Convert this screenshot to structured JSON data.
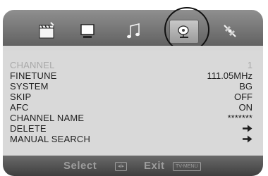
{
  "tabs": [
    {
      "icon": "clapperboard-icon",
      "selected": false
    },
    {
      "icon": "monitor-icon",
      "selected": false
    },
    {
      "icon": "music-note-icon",
      "selected": false
    },
    {
      "icon": "satellite-dish-icon",
      "selected": true
    },
    {
      "icon": "satellite-icon",
      "selected": false
    }
  ],
  "menu": {
    "items": [
      {
        "label": "CHANNEL",
        "value": "1",
        "disabled": true
      },
      {
        "label": "FINETUNE",
        "value": "111.05MHz"
      },
      {
        "label": "SYSTEM",
        "value": "BG"
      },
      {
        "label": "SKIP",
        "value": "OFF"
      },
      {
        "label": "AFC",
        "value": "ON"
      },
      {
        "label": "CHANNEL NAME",
        "value": "*******"
      },
      {
        "label": "DELETE",
        "value": "",
        "value_icon": "arrow-right-icon"
      },
      {
        "label": "MANUAL SEARCH",
        "value": "",
        "value_icon": "arrow-right-icon"
      }
    ]
  },
  "footer": {
    "select_label": "Select",
    "select_key": "◂/▸",
    "exit_label": "Exit",
    "exit_key": "TV-MENU"
  },
  "colors": {
    "panel": "#d9d9d9",
    "tabbar": "#6f6f6f",
    "bottombar": "#4a4a4a",
    "text": "#1f1f1f",
    "disabled_text": "#a8a8a8"
  }
}
